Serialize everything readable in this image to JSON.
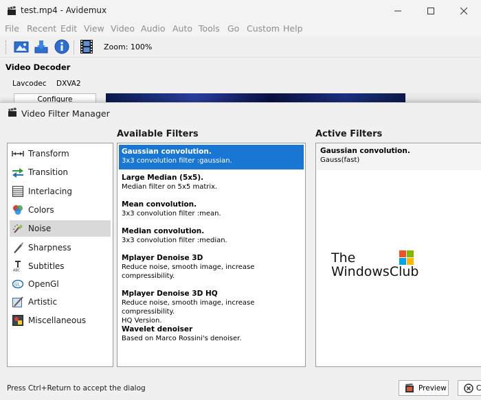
{
  "window": {
    "title": "test.mp4 - Avidemux"
  },
  "menu": [
    "File",
    "Recent",
    "Edit",
    "View",
    "Video",
    "Audio",
    "Auto",
    "Tools",
    "Go",
    "Custom",
    "Help"
  ],
  "toolbar": {
    "zoom": "Zoom: 100%"
  },
  "video_decoder": {
    "title": "Video Decoder",
    "lavcodec": "Lavcodec",
    "dxva2": "DXVA2",
    "configure": "Configure"
  },
  "dialog": {
    "title": "Video Filter Manager",
    "available_heading": "Available Filters",
    "active_heading": "Active Filters",
    "categories": [
      {
        "label": "Transform",
        "icon": "transform-icon"
      },
      {
        "label": "Transition",
        "icon": "transition-icon"
      },
      {
        "label": "Interlacing",
        "icon": "interlacing-icon"
      },
      {
        "label": "Colors",
        "icon": "colors-icon"
      },
      {
        "label": "Noise",
        "icon": "noise-icon",
        "selected": true
      },
      {
        "label": "Sharpness",
        "icon": "sharpness-icon"
      },
      {
        "label": "Subtitles",
        "icon": "subtitles-icon"
      },
      {
        "label": "OpenGl",
        "icon": "opengl-icon"
      },
      {
        "label": "Artistic",
        "icon": "artistic-icon"
      },
      {
        "label": "Miscellaneous",
        "icon": "miscellaneous-icon"
      }
    ],
    "filters": [
      {
        "name": "Gaussian convolution.",
        "desc": "3x3 convolution filter :gaussian.",
        "selected": true
      },
      {
        "name": "Large Median (5x5).",
        "desc": "Median filter on 5x5 matrix."
      },
      {
        "name": "Mean convolution.",
        "desc": "3x3 convolution filter :mean."
      },
      {
        "name": "Median convolution.",
        "desc": "3x3 convolution filter :median."
      },
      {
        "name": "Mplayer Denoise 3D",
        "desc": "Reduce noise, smooth image, increase compressibility."
      },
      {
        "name": "Mplayer Denoise 3D HQ",
        "desc": "Reduce noise, smooth image, increase compressibility.",
        "desc2": "HQ Version."
      },
      {
        "name": "Wavelet denoiser",
        "desc": "Based on Marco Rossini's denoiser."
      }
    ],
    "active_filters": [
      {
        "name": "Gaussian convolution.",
        "desc": "Gauss(fast)"
      }
    ],
    "watermark": {
      "line1": "The",
      "line2": "WindowsClub"
    },
    "hint": "Press Ctrl+Return to accept the dialog",
    "preview_label": "Preview",
    "close_label": "Cl"
  },
  "colors": {
    "selection": "#1976d2",
    "category_selected": "#d9d9d9"
  }
}
